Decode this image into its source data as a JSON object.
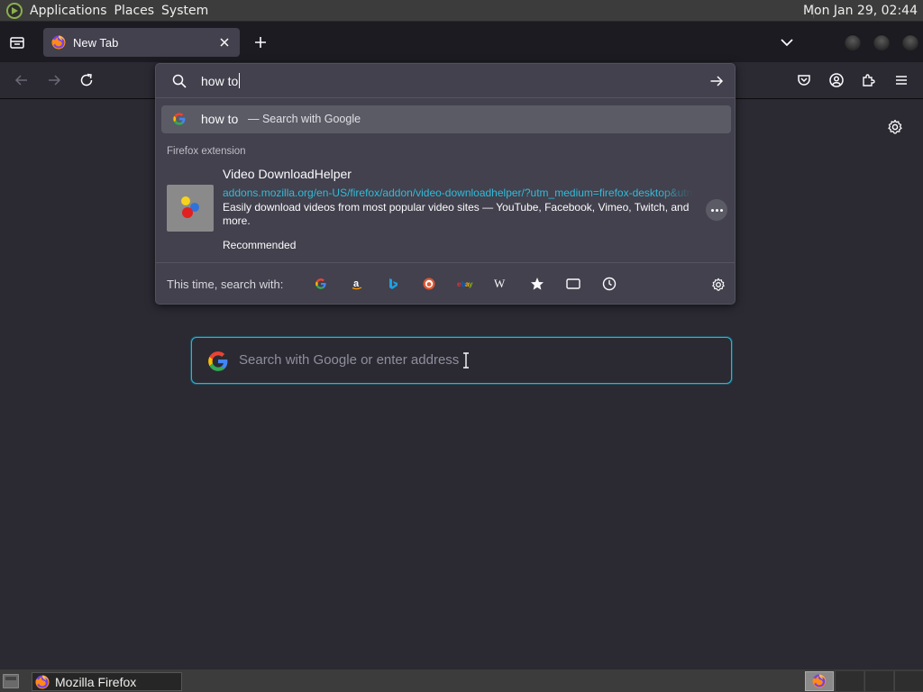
{
  "top_panel": {
    "menus": [
      "Applications",
      "Places",
      "System"
    ],
    "clock": "Mon Jan 29, 02:44"
  },
  "browser": {
    "tab": {
      "title": "New Tab"
    },
    "url_query": "how to",
    "popup": {
      "google_result": {
        "query": "how to",
        "action": "— Search with Google"
      },
      "extension_group_label": "Firefox extension",
      "extension": {
        "name": "Video DownloadHelper",
        "url": "addons.mozilla.org/en-US/firefox/addon/video-downloadhelper/?utm_medium=firefox-desktop&utm",
        "description": "Easily download videos from most popular video sites — YouTube, Facebook, Vimeo, Twitch, and more.",
        "tag": "Recommended"
      },
      "oneoff": {
        "label": "This time, search with:",
        "engines": [
          "Google",
          "Amazon.com",
          "Bing",
          "DuckDuckGo",
          "eBay",
          "Wikipedia (en)",
          "Bookmarks",
          "Tabs",
          "History"
        ]
      }
    },
    "newtab": {
      "search_placeholder": "Search with Google or enter address"
    }
  },
  "taskbar": {
    "task_label": "Mozilla Firefox"
  },
  "colors": {
    "accent": "#00ddff",
    "url_link": "#33bbd9",
    "selected_row": "#5b5b66",
    "page_bg": "#2b2a33"
  }
}
